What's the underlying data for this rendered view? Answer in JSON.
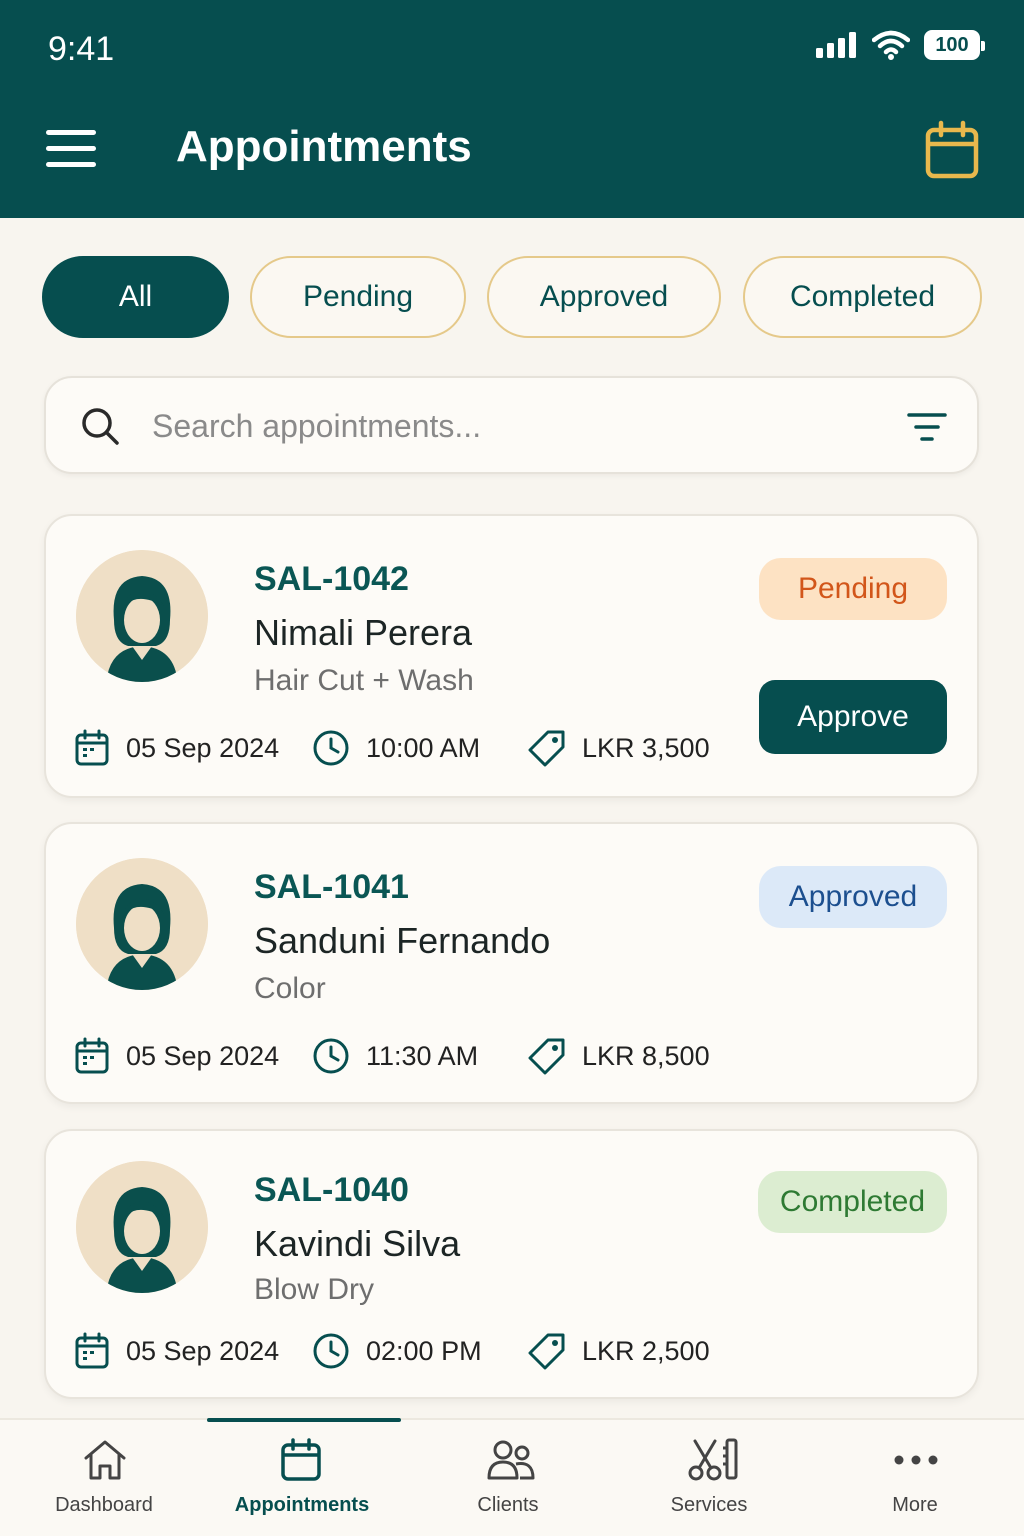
{
  "status_bar": {
    "time": "9:41",
    "battery": "100"
  },
  "header": {
    "title": "Appointments"
  },
  "filters": [
    {
      "label": "All",
      "active": true
    },
    {
      "label": "Pending",
      "active": false
    },
    {
      "label": "Approved",
      "active": false
    },
    {
      "label": "Completed",
      "active": false
    }
  ],
  "search": {
    "placeholder": "Search appointments...",
    "value": ""
  },
  "appointments": [
    {
      "id": "SAL-1042",
      "name": "Nimali Perera",
      "service": "Hair Cut + Wash",
      "date": "05 Sep 2024",
      "time": "10:00 AM",
      "price": "LKR 3,500",
      "status": "Pending",
      "action_label": "Approve"
    },
    {
      "id": "SAL-1041",
      "name": "Sanduni Fernando",
      "service": "Color",
      "date": "05 Sep 2024",
      "time": "11:30 AM",
      "price": "LKR 8,500",
      "status": "Approved"
    },
    {
      "id": "SAL-1040",
      "name": "Kavindi Silva",
      "service": "Blow Dry",
      "date": "05 Sep 2024",
      "time": "02:00 PM",
      "price": "LKR 2,500",
      "status": "Completed"
    }
  ],
  "status_colors": {
    "Pending": {
      "bg": "#fde2c3",
      "fg": "#d2561a"
    },
    "Approved": {
      "bg": "#dce9f8",
      "fg": "#1c4f8f"
    },
    "Completed": {
      "bg": "#dcedd1",
      "fg": "#2e7a33"
    }
  },
  "bottom_nav": [
    {
      "label": "Dashboard",
      "icon": "home-icon"
    },
    {
      "label": "Appointments",
      "icon": "calendar-icon",
      "active": true
    },
    {
      "label": "Clients",
      "icon": "users-icon"
    },
    {
      "label": "Services",
      "icon": "scissors-icon"
    },
    {
      "label": "More",
      "icon": "more-icon"
    }
  ],
  "colors": {
    "primary": "#064e4f",
    "accent": "#e8b84d",
    "chip_border": "#e5c98a"
  }
}
